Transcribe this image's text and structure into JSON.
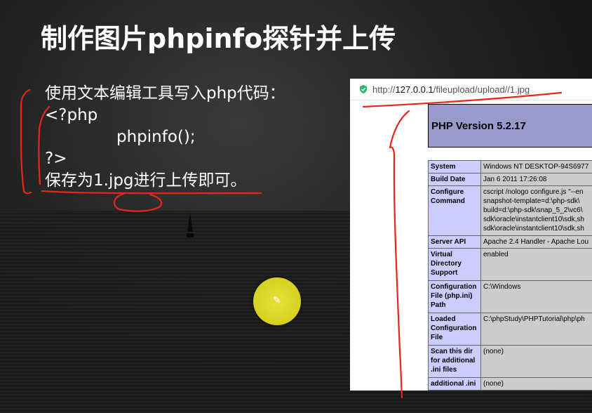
{
  "slide": {
    "title": "制作图片phpinfo探针并上传",
    "lines": [
      "使用文本编辑工具写入php代码：",
      "<?php",
      "phpinfo();",
      "?>",
      "保存为1.jpg进行上传即可。"
    ]
  },
  "browser": {
    "url_prefix": "http://",
    "url_host": "127.0.0.1",
    "url_path": "/fileupload/upload//1.jpg",
    "php_version": "PHP Version 5.2.17",
    "rows": [
      {
        "key": "System",
        "value": "Windows NT DESKTOP-94S6977"
      },
      {
        "key": "Build Date",
        "value": "Jan 6 2011 17:26:08"
      },
      {
        "key": "Configure Command",
        "value": "cscript /nologo configure.js \"--en\nsnapshot-template=d:\\php-sdk\\\nbuild=d:\\php-sdk\\snap_5_2\\vc6\\\nsdk\\oracle\\instantclient10\\sdk,sh\nsdk\\oracle\\instantclient10\\sdk,sh"
      },
      {
        "key": "Server API",
        "value": "Apache 2.4 Handler - Apache Lou"
      },
      {
        "key": "Virtual Directory Support",
        "value": "enabled"
      },
      {
        "key": "Configuration File (php.ini) Path",
        "value": "C:\\Windows"
      },
      {
        "key": "Loaded Configuration File",
        "value": "C:\\phpStudy\\PHPTutorial\\php\\ph"
      },
      {
        "key": "Scan this dir for additional .ini files",
        "value": "(none)"
      },
      {
        "key": "additional .ini",
        "value": "(none)"
      }
    ]
  },
  "colors": {
    "php_header": "#9999cc",
    "key_cell": "#ccccff",
    "value_cell": "#cccccc",
    "annotation": "#e8261a",
    "pointer": "#d8d020"
  },
  "icons": [
    "shield-icon",
    "pen-icon",
    "sailboat-icon"
  ]
}
